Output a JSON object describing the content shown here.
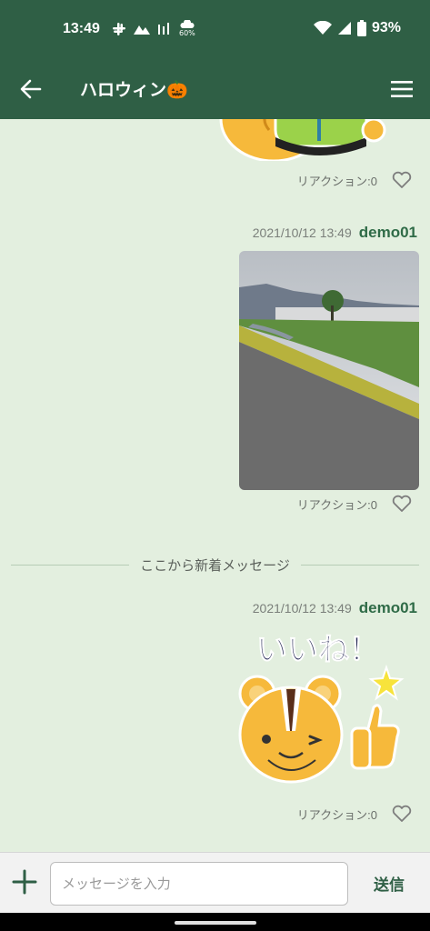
{
  "status": {
    "time": "13:49",
    "weather_pct": "60%",
    "battery": "93%"
  },
  "appbar": {
    "title": "ハロウィン🎃"
  },
  "messages": [
    {
      "reaction_label": "リアクション:0"
    },
    {
      "date": "2021/10/12 13:49",
      "user": "demo01",
      "reaction_label": "リアクション:0"
    },
    {
      "date": "2021/10/12 13:49",
      "user": "demo01",
      "sticker_text": "いいね！",
      "reaction_label": "リアクション:0"
    }
  ],
  "divider": {
    "label": "ここから新着メッセージ"
  },
  "input": {
    "placeholder": "メッセージを入力",
    "send_label": "送信"
  },
  "colors": {
    "header": "#2f5f45",
    "background": "#e3efdf",
    "username": "#2f6b47"
  }
}
